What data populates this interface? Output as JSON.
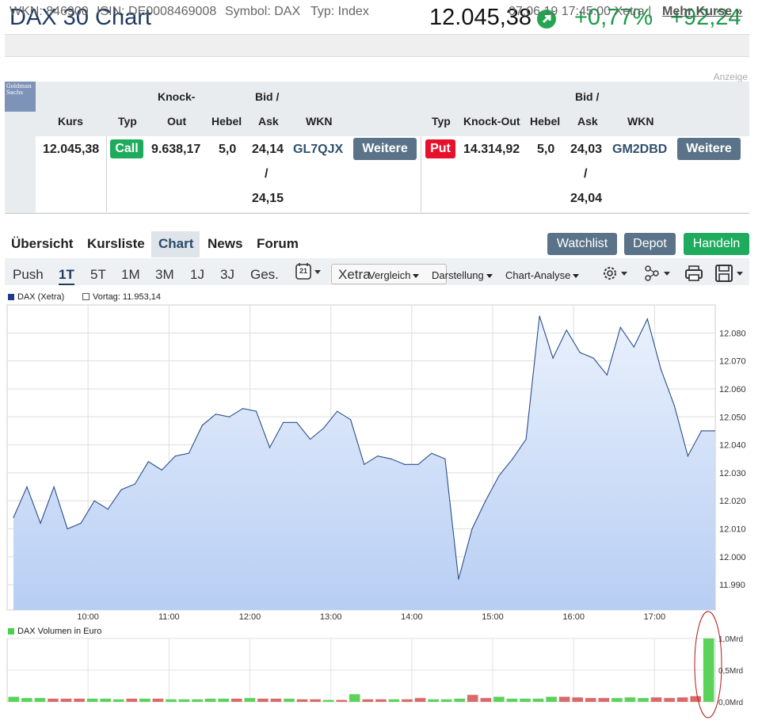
{
  "header": {
    "title": "DAX 30 Chart",
    "price": "12.045,38",
    "change_pct": "+0,77%",
    "change_abs": "+92,24"
  },
  "infobar": {
    "wkn": "WKN: 846900",
    "isin": "ISIN: DE0008469008",
    "symbol": "Symbol: DAX",
    "typ": "Typ: Index",
    "timestamp": "07.06.19 17:45:00 Xetra |",
    "more": "Mehr Kurse »"
  },
  "ad": {
    "anzeige": "Anzeige",
    "logo": "Goldman Sachs",
    "headers": {
      "kurs": "Kurs",
      "typ": "Typ",
      "knock": "Knock-",
      "out": "Out",
      "hebel": "Hebel",
      "bid": "Bid /",
      "ask": "Ask",
      "wkn": "WKN",
      "knockout": "Knock-Out"
    },
    "kurs": "12.045,38",
    "call": {
      "typ": "Call",
      "ko": "9.638,17",
      "hebel": "5,0",
      "bid": "24,14",
      "slash": "/",
      "ask": "24,15",
      "wkn": "GL7QJX",
      "button": "Weitere"
    },
    "put": {
      "typ": "Put",
      "ko": "14.314,92",
      "hebel": "5,0",
      "bid": "24,03",
      "slash": "/",
      "ask": "24,04",
      "wkn": "GM2DBD",
      "button": "Weitere"
    }
  },
  "tabs": [
    "Übersicht",
    "Kursliste",
    "Chart",
    "News",
    "Forum"
  ],
  "buttons": {
    "watchlist": "Watchlist",
    "depot": "Depot",
    "handeln": "Handeln"
  },
  "colors": {
    "watchlist": "#5a7388",
    "depot": "#5a7388",
    "handeln": "#1fab5e",
    "call": "#1fab5e",
    "put": "#e8102a"
  },
  "toolbar": {
    "ranges": [
      "Push",
      "1T",
      "5T",
      "1M",
      "3M",
      "1J",
      "3J",
      "Ges."
    ],
    "selected": "1T",
    "calendar": "21",
    "exchange": "Xetra",
    "vergleich": "Vergleich",
    "darstellung": "Darstellung",
    "analyse": "Chart-Analyse"
  },
  "chart_data": [
    {
      "type": "area",
      "legend": [
        "DAX (Xetra)",
        "Vortag: 11.953,14"
      ],
      "x_ticks": [
        "10:00",
        "11:00",
        "12:00",
        "13:00",
        "14:00",
        "15:00",
        "16:00",
        "17:00"
      ],
      "xlim": [
        "09:00",
        "17:45"
      ],
      "y_ticks": [
        "11.990",
        "12.000",
        "12.010",
        "12.020",
        "12.030",
        "12.040",
        "12.050",
        "12.060",
        "12.070",
        "12.080"
      ],
      "ylim": [
        11981,
        12090
      ],
      "grid": true,
      "series": [
        {
          "name": "DAX (Xetra)",
          "times": [
            "09:00",
            "09:10",
            "09:20",
            "09:30",
            "09:40",
            "09:50",
            "10:00",
            "10:10",
            "10:20",
            "10:30",
            "10:40",
            "10:50",
            "11:00",
            "11:10",
            "11:20",
            "11:30",
            "11:40",
            "11:50",
            "12:00",
            "12:10",
            "12:20",
            "12:30",
            "12:40",
            "12:50",
            "13:00",
            "13:10",
            "13:20",
            "13:30",
            "13:40",
            "13:50",
            "14:00",
            "14:10",
            "14:20",
            "14:30",
            "14:40",
            "14:50",
            "15:00",
            "15:10",
            "15:20",
            "15:30",
            "15:40",
            "15:50",
            "16:00",
            "16:10",
            "16:20",
            "16:30",
            "16:40",
            "16:50",
            "17:00",
            "17:10",
            "17:20",
            "17:30",
            "17:40"
          ],
          "values": [
            12014,
            12025,
            12012,
            12025,
            12010,
            12012,
            12020,
            12017,
            12024,
            12026,
            12034,
            12031,
            12036,
            12037,
            12047,
            12051,
            12050,
            12053,
            12052,
            12039,
            12048,
            12048,
            12042,
            12046,
            12052,
            12049,
            12033,
            12036,
            12035,
            12033,
            12033,
            12037,
            12035,
            11992,
            12010,
            12020,
            12029,
            12035,
            12042,
            12086,
            12071,
            12081,
            12073,
            12071,
            12065,
            12082,
            12075,
            12085,
            12067,
            12054,
            12036,
            12045,
            12045
          ]
        }
      ]
    },
    {
      "type": "bar",
      "legend": [
        "DAX Volumen in Euro"
      ],
      "y_ticks": [
        "0,0Mrd",
        "0,5Mrd",
        "1,0Mrd"
      ],
      "ylim": [
        0,
        1.0
      ],
      "series": [
        {
          "name": "DAX Volumen in Euro",
          "values": [
            0.08,
            0.06,
            0.06,
            0.05,
            0.05,
            0.05,
            0.05,
            0.05,
            0.04,
            0.05,
            0.05,
            0.05,
            0.04,
            0.04,
            0.04,
            0.05,
            0.05,
            0.05,
            0.06,
            0.05,
            0.05,
            0.05,
            0.04,
            0.04,
            0.03,
            0.03,
            0.12,
            0.04,
            0.04,
            0.04,
            0.04,
            0.06,
            0.04,
            0.04,
            0.05,
            0.11,
            0.06,
            0.08,
            0.05,
            0.05,
            0.05,
            0.08,
            0.08,
            0.07,
            0.06,
            0.06,
            0.06,
            0.07,
            0.06,
            0.07,
            0.06,
            0.07,
            0.09,
            1.0
          ],
          "colors": [
            "g",
            "g",
            "g",
            "r",
            "r",
            "r",
            "g",
            "g",
            "g",
            "r",
            "g",
            "r",
            "g",
            "g",
            "g",
            "g",
            "g",
            "r",
            "g",
            "r",
            "r",
            "g",
            "r",
            "r",
            "g",
            "r",
            "g",
            "r",
            "r",
            "g",
            "r",
            "r",
            "g",
            "g",
            "g",
            "r",
            "r",
            "g",
            "g",
            "g",
            "g",
            "g",
            "r",
            "r",
            "r",
            "r",
            "g",
            "g",
            "g",
            "r",
            "r",
            "r",
            "r",
            "g"
          ]
        }
      ]
    }
  ]
}
